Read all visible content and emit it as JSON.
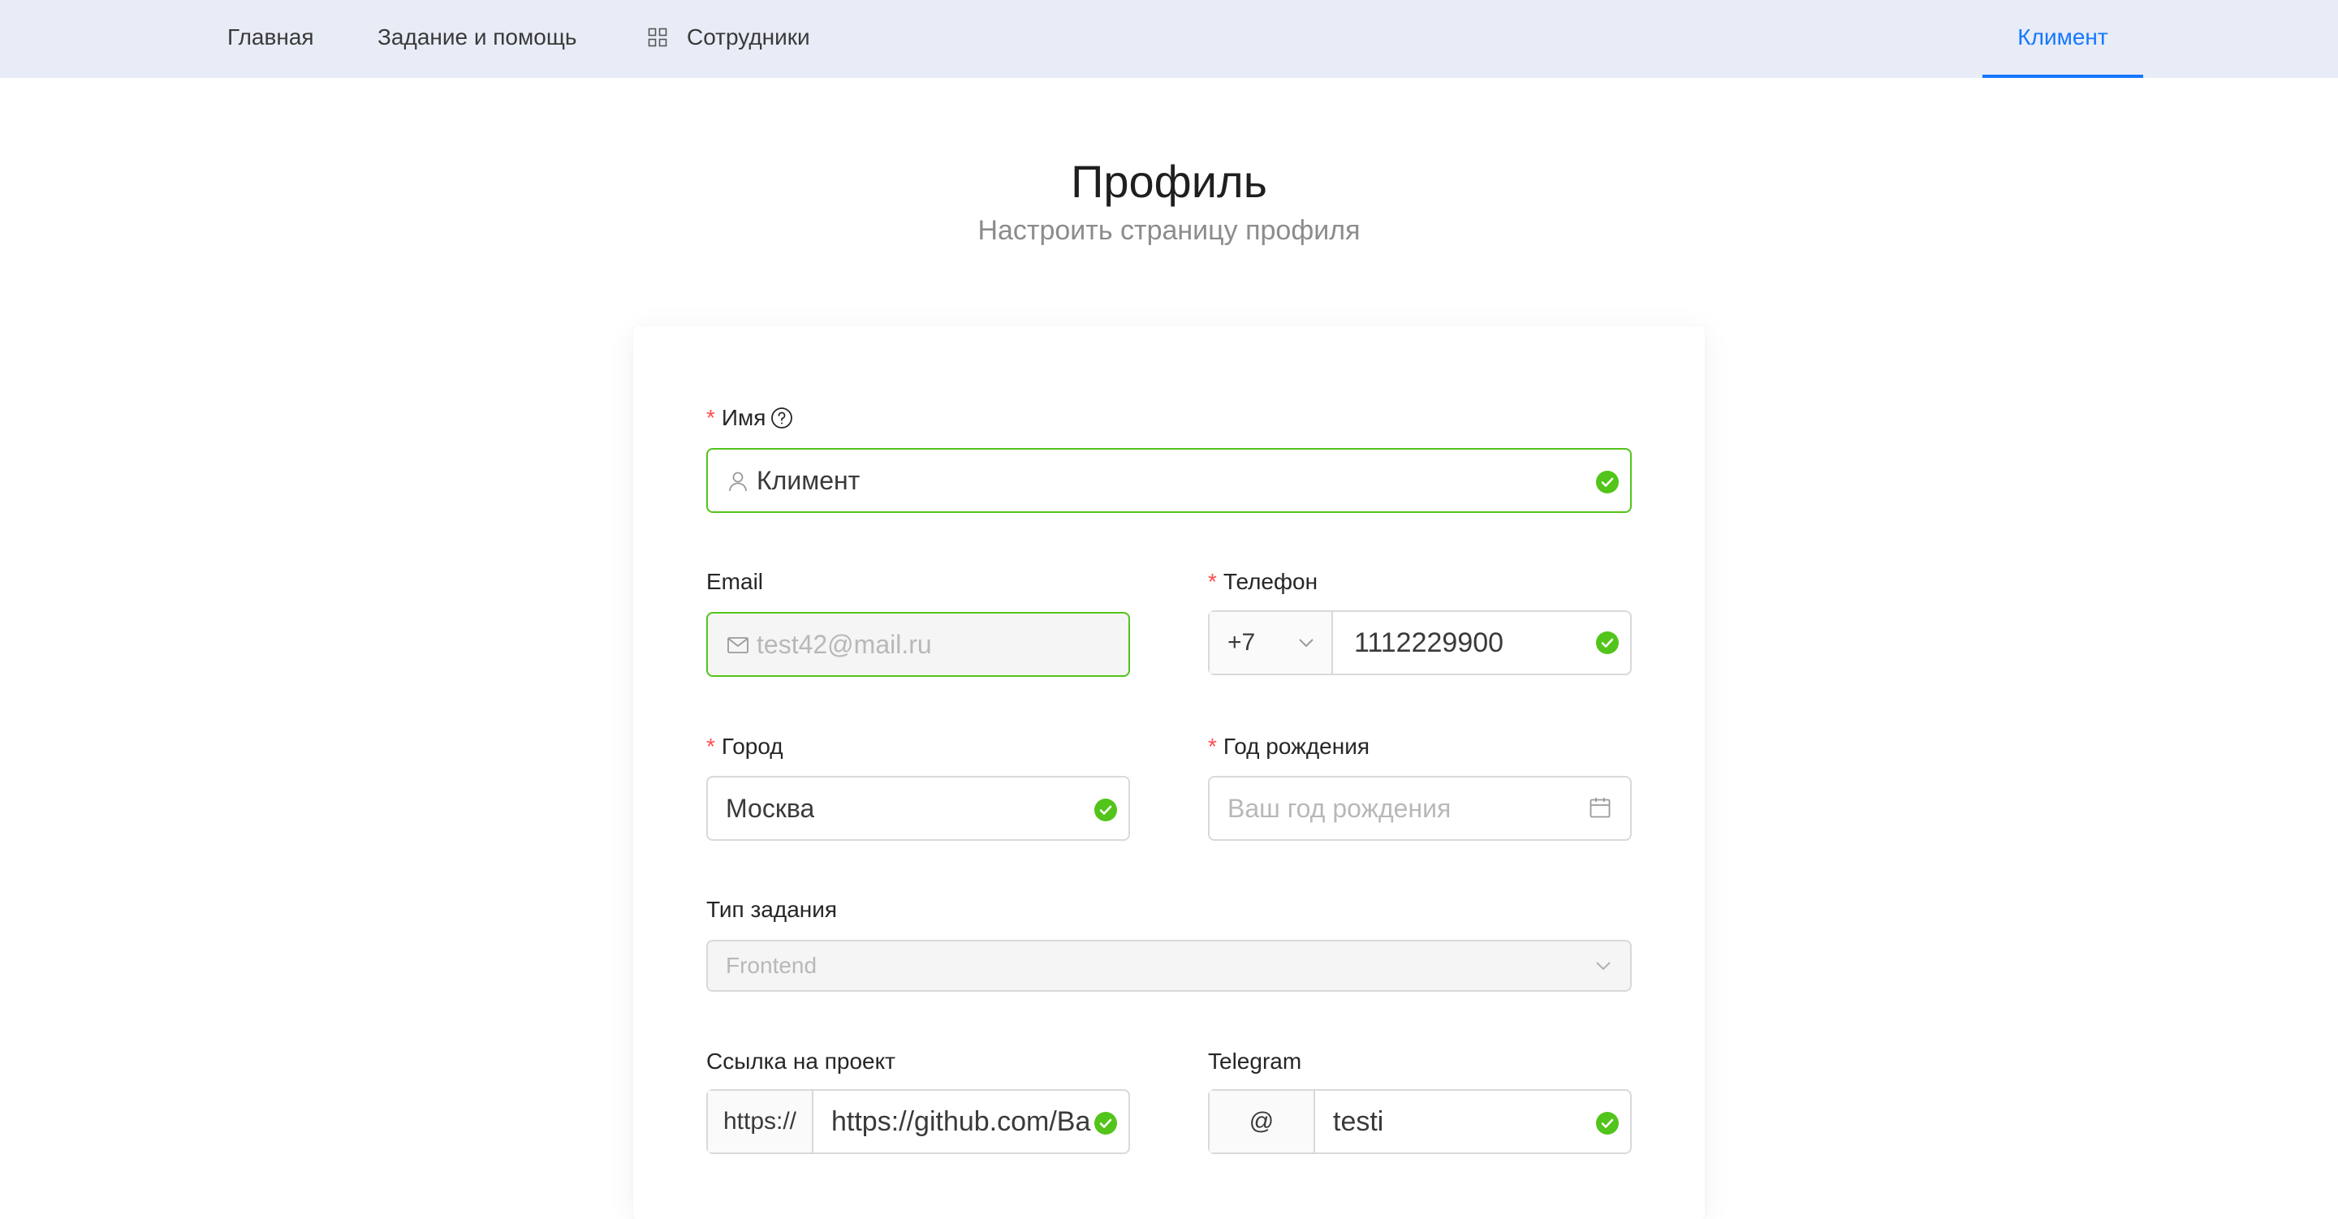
{
  "nav": {
    "items": [
      "Главная",
      "Задание и помощь",
      "Сотрудники"
    ],
    "user": "Климент",
    "icons": {
      "employees": "grid-icon"
    },
    "accent_color": "#1677ff"
  },
  "header": {
    "title": "Профиль",
    "subtitle": "Настроить страницу профиля"
  },
  "form": {
    "name": {
      "label": "Имя",
      "required": true,
      "value": "Климент",
      "icon": "user-icon",
      "status": "success"
    },
    "email": {
      "label": "Email",
      "value": "test42@mail.ru",
      "icon": "mail-icon",
      "disabled": true
    },
    "phone": {
      "label": "Телефон",
      "required": true,
      "country_code": "+7",
      "value": "1112229900",
      "status": "success"
    },
    "city": {
      "label": "Город",
      "required": true,
      "value": "Москва",
      "status": "success"
    },
    "birth_year": {
      "label": "Год рождения",
      "required": true,
      "placeholder": "Ваш год рождения",
      "icon": "calendar-icon"
    },
    "task_type": {
      "label": "Тип задания",
      "value": "Frontend",
      "disabled": true
    },
    "project_link": {
      "label": "Ссылка на проект",
      "prefix": "https://",
      "value": "https://github.com/Ba",
      "status": "success"
    },
    "telegram": {
      "label": "Telegram",
      "prefix": "@",
      "value": "testi",
      "status": "success"
    },
    "success_color": "#52c41a",
    "required_color": "#ff4d4f"
  }
}
